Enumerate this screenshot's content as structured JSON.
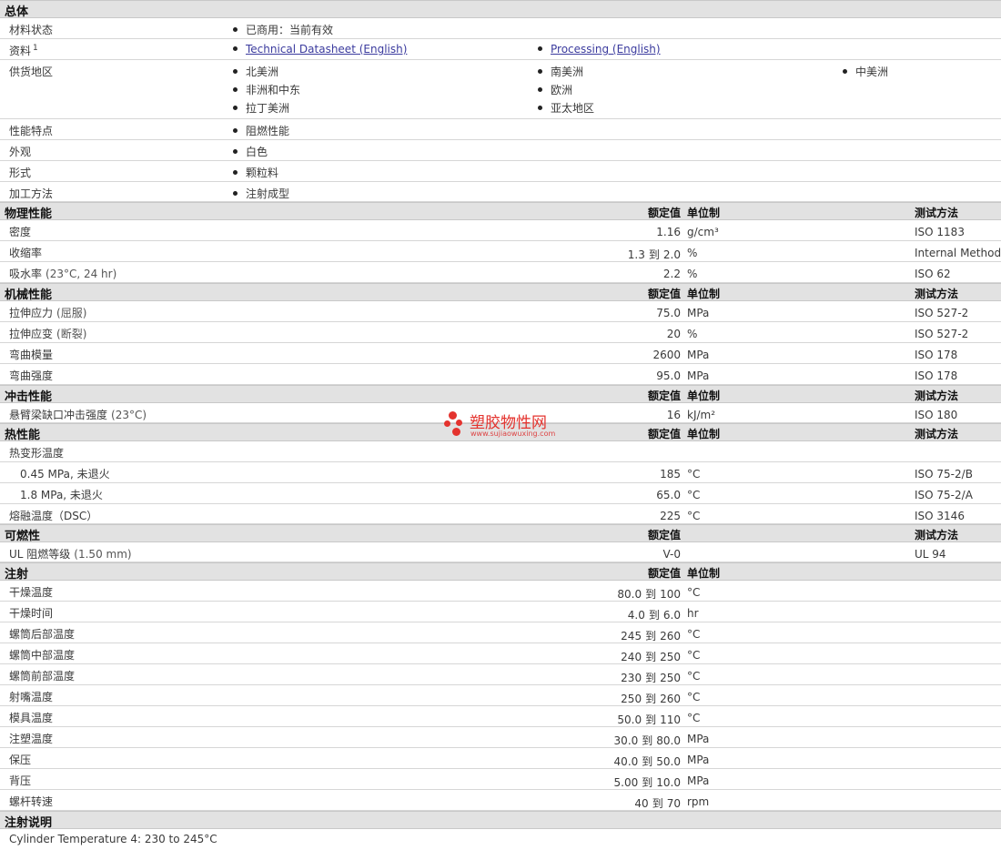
{
  "general": {
    "title": "总体",
    "status": {
      "label": "材料状态",
      "value": "已商用：当前有效"
    },
    "docs": {
      "label": "资料",
      "sup": "1",
      "link1": "Technical Datasheet (English)",
      "link2": "Processing (English)"
    },
    "regions": {
      "label": "供货地区",
      "items": [
        "北美洲",
        "南美洲",
        "中美洲",
        "非洲和中东",
        "欧洲",
        "拉丁美洲",
        "亚太地区"
      ]
    },
    "features": {
      "label": "性能特点",
      "value": "阻燃性能"
    },
    "appearance": {
      "label": "外观",
      "value": "白色"
    },
    "form": {
      "label": "形式",
      "value": "颗粒料"
    },
    "processing": {
      "label": "加工方法",
      "value": "注射成型"
    }
  },
  "headers": {
    "value": "额定值",
    "unit": "单位制",
    "method": "测试方法"
  },
  "physical": {
    "title": "物理性能",
    "rows": [
      {
        "label": "密度",
        "value": "1.16",
        "unit": "g/cm³",
        "method": "ISO 1183"
      },
      {
        "label": "收缩率",
        "from": "1.3",
        "to_word": "到",
        "to": "2.0",
        "unit": "%",
        "method": "Internal Method"
      },
      {
        "label": "吸水率",
        "cond": "(23°C, 24 hr)",
        "value": "2.2",
        "unit": "%",
        "method": "ISO 62"
      }
    ]
  },
  "mechanical": {
    "title": "机械性能",
    "rows": [
      {
        "label": "拉伸应力",
        "cond": "(屈服)",
        "value": "75.0",
        "unit": "MPa",
        "method": "ISO 527-2"
      },
      {
        "label": "拉伸应变",
        "cond": "(断裂)",
        "value": "20",
        "unit": "%",
        "method": "ISO 527-2"
      },
      {
        "label": "弯曲模量",
        "value": "2600",
        "unit": "MPa",
        "method": "ISO 178"
      },
      {
        "label": "弯曲强度",
        "value": "95.0",
        "unit": "MPa",
        "method": "ISO 178"
      }
    ]
  },
  "impact": {
    "title": "冲击性能",
    "rows": [
      {
        "label": "悬臂梁缺口冲击强度",
        "cond": "(23°C)",
        "value": "16",
        "unit": "kJ/m²",
        "method": "ISO 180"
      }
    ]
  },
  "thermal": {
    "title": "热性能",
    "hdt_label": "热变形温度",
    "rows": [
      {
        "label": "0.45 MPa, 未退火",
        "value": "185",
        "unit": "°C",
        "method": "ISO 75-2/B"
      },
      {
        "label": "1.8 MPa, 未退火",
        "value": "65.0",
        "unit": "°C",
        "method": "ISO 75-2/A"
      },
      {
        "label": "熔融温度（DSC）",
        "value": "225",
        "unit": "°C",
        "method": "ISO 3146"
      }
    ]
  },
  "flammability": {
    "title": "可燃性",
    "rows": [
      {
        "label": "UL 阻燃等级",
        "cond": "(1.50 mm)",
        "value": "V-0",
        "method": "UL 94"
      }
    ]
  },
  "injection": {
    "title": "注射",
    "rows": [
      {
        "label": "干燥温度",
        "from": "80.0",
        "to": "100",
        "unit": "°C"
      },
      {
        "label": "干燥时间",
        "from": "4.0",
        "to": "6.0",
        "unit": "hr"
      },
      {
        "label": "螺筒后部温度",
        "from": "245",
        "to": "260",
        "unit": "°C"
      },
      {
        "label": "螺筒中部温度",
        "from": "240",
        "to": "250",
        "unit": "°C"
      },
      {
        "label": "螺筒前部温度",
        "from": "230",
        "to": "250",
        "unit": "°C"
      },
      {
        "label": "射嘴温度",
        "from": "250",
        "to": "260",
        "unit": "°C"
      },
      {
        "label": "模具温度",
        "from": "50.0",
        "to": "110",
        "unit": "°C"
      },
      {
        "label": "注塑温度",
        "from": "30.0",
        "to": "80.0",
        "unit": "MPa"
      },
      {
        "label": "保压",
        "from": "40.0",
        "to": "50.0",
        "unit": "MPa"
      },
      {
        "label": "背压",
        "from": "5.00",
        "to": "10.0",
        "unit": "MPa"
      },
      {
        "label": "螺杆转速",
        "from": "40",
        "to": "70",
        "unit": "rpm"
      }
    ],
    "to_word": "到"
  },
  "notes": {
    "title": "注射说明",
    "text": "Cylinder Temperature 4: 230 to 245°C"
  },
  "watermark": {
    "text": "塑胶物性网",
    "url": "www.sujiaowuxing.com",
    "color": "#e4332e"
  }
}
